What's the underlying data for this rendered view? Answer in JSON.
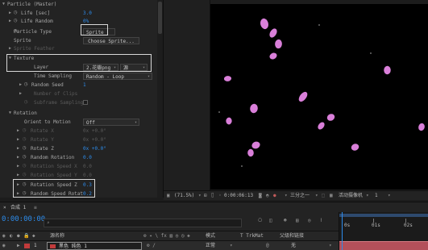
{
  "effect_controls": {
    "rows": [
      {
        "key": "particle_header",
        "label": "Particle (Master)",
        "value": ""
      },
      {
        "key": "life",
        "label": "Life [sec]",
        "value": "3.0"
      },
      {
        "key": "life_random",
        "label": "Life Random",
        "value": "0%"
      },
      {
        "key": "particle_type",
        "label": "Particle Type",
        "value": ""
      },
      {
        "key": "sprite",
        "label": "Sprite",
        "value": ""
      },
      {
        "key": "sprite_feather",
        "label": "Sprite Feather",
        "value": ""
      },
      {
        "key": "texture",
        "label": "Texture",
        "value": ""
      },
      {
        "key": "layer",
        "label": "Layer",
        "value": ""
      },
      {
        "key": "time_sampling",
        "label": "Time Sampling",
        "value": ""
      },
      {
        "key": "random_seed",
        "label": "Random Seed",
        "value": "1"
      },
      {
        "key": "number_of_clips",
        "label": "Number of Clips",
        "value": ""
      },
      {
        "key": "subframe_sampling",
        "label": "Subframe Sampling",
        "value": ""
      },
      {
        "key": "rotation",
        "label": "Rotation",
        "value": ""
      },
      {
        "key": "orient_to_motion",
        "label": "Orient to Motion",
        "value": ""
      },
      {
        "key": "rotate_x",
        "label": "Rotate X",
        "value": "0x +0.0°"
      },
      {
        "key": "rotate_y",
        "label": "Rotate Y",
        "value": "0x +0.0°"
      },
      {
        "key": "rotate_z",
        "label": "Rotate Z",
        "value": "0x +0.0°"
      },
      {
        "key": "random_rotation",
        "label": "Random Rotation",
        "value": "0.0"
      },
      {
        "key": "rotation_speed_x",
        "label": "Rotation Speed X",
        "value": "0.0"
      },
      {
        "key": "rotation_speed_y",
        "label": "Rotation Speed Y",
        "value": "0.0"
      },
      {
        "key": "rotation_speed_z",
        "label": "Rotation Speed Z",
        "value": "0.3"
      },
      {
        "key": "random_speed_rotate",
        "label": "Random Speed Rotat",
        "value": "0.2"
      }
    ],
    "particle_type_value": "Sprite",
    "choose_sprite_button": "Choose Sprite...",
    "layer_value": "2.花瓣png",
    "layer_source": "源",
    "time_sampling_value": "Random - Loop",
    "orient_to_motion_value": "Off"
  },
  "viewer_bar": {
    "zoom": "(71.5%)",
    "timecode": "0:00:06:13",
    "resolution": "三分之一",
    "camera": "活动摄像机",
    "view_count": "1"
  },
  "timeline": {
    "comp_tab": "合成 1",
    "current_time": "0:00:00:00",
    "search_placeholder": "",
    "columns": {
      "layer_name": "源名称",
      "mode": "模式",
      "trkmat": "T  TrkMat",
      "parent": "父级和链接"
    },
    "layer": {
      "index": "1",
      "name": "黑色 纯色 1",
      "mode": "正常",
      "parent": "无"
    },
    "ruler": {
      "marks": [
        "0s",
        "01s",
        "02s"
      ]
    }
  },
  "colors": {
    "value_blue": "#2d8ceb",
    "petal_pink": "#d97fd9",
    "layer_bar": "#b3505a",
    "label_red": "#c23b3b"
  }
}
